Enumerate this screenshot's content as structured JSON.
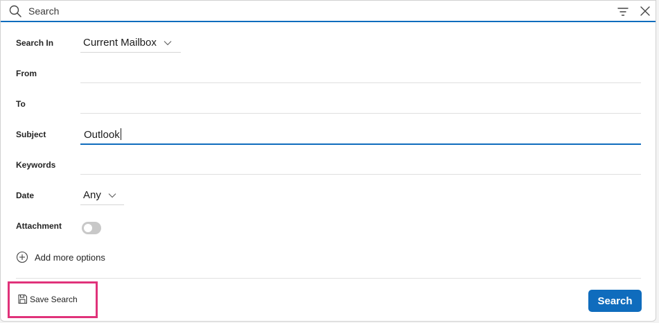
{
  "search": {
    "placeholder": "Search"
  },
  "form": {
    "search_in": {
      "label": "Search In",
      "value": "Current Mailbox"
    },
    "from": {
      "label": "From",
      "value": ""
    },
    "to": {
      "label": "To",
      "value": ""
    },
    "subject": {
      "label": "Subject",
      "value": "Outlook"
    },
    "keywords": {
      "label": "Keywords",
      "value": ""
    },
    "date": {
      "label": "Date",
      "value": "Any"
    },
    "attachment": {
      "label": "Attachment",
      "enabled": false
    }
  },
  "add_more_label": "Add more options",
  "footer": {
    "save_search_label": "Save Search",
    "search_button_label": "Search"
  },
  "colors": {
    "accent": "#0f6cbd",
    "highlight": "#e0327a",
    "toggle_off": "#c8c8c8"
  },
  "icons": [
    "search-icon",
    "filter-icon",
    "close-icon",
    "chevron-down-icon",
    "add-circle-icon",
    "save-icon"
  ]
}
